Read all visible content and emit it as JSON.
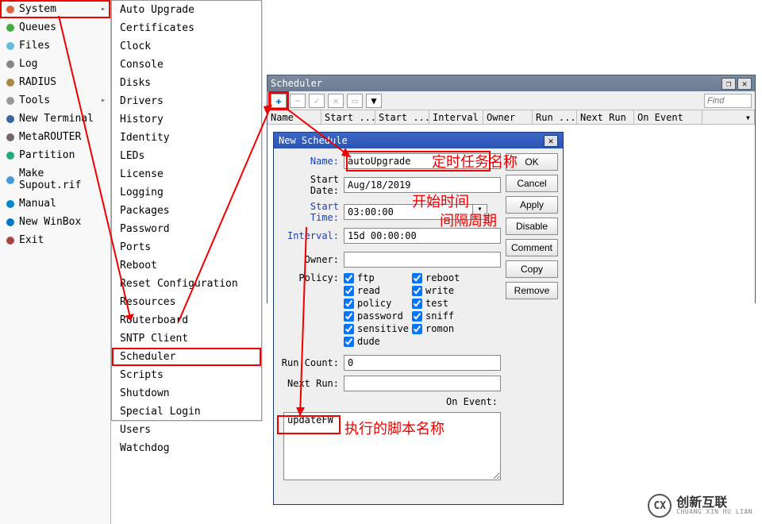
{
  "sidebar": {
    "items": [
      {
        "label": "System",
        "icon": "gear-icon",
        "highlight": true,
        "expandable": true
      },
      {
        "label": "Queues",
        "icon": "tree-icon"
      },
      {
        "label": "Files",
        "icon": "folder-icon"
      },
      {
        "label": "Log",
        "icon": "list-icon"
      },
      {
        "label": "RADIUS",
        "icon": "shield-icon"
      },
      {
        "label": "Tools",
        "icon": "wrench-icon",
        "expandable": true
      },
      {
        "label": "New Terminal",
        "icon": "terminal-icon"
      },
      {
        "label": "MetaROUTER",
        "icon": "router-icon"
      },
      {
        "label": "Partition",
        "icon": "pie-icon"
      },
      {
        "label": "Make Supout.rif",
        "icon": "doc-icon"
      },
      {
        "label": "Manual",
        "icon": "help-icon"
      },
      {
        "label": "New WinBox",
        "icon": "globe-icon"
      },
      {
        "label": "Exit",
        "icon": "exit-icon"
      }
    ]
  },
  "submenu": {
    "items": [
      "Auto Upgrade",
      "Certificates",
      "Clock",
      "Console",
      "Disks",
      "Drivers",
      "History",
      "Identity",
      "LEDs",
      "License",
      "Logging",
      "Packages",
      "Password",
      "Ports",
      "Reboot",
      "Reset Configuration",
      "Resources",
      "Routerboard",
      "SNTP Client",
      "Scheduler",
      "Scripts",
      "Shutdown",
      "Special Login",
      "Users",
      "Watchdog"
    ],
    "highlight_index": 19
  },
  "scheduler_window": {
    "title": "Scheduler",
    "find_placeholder": "Find",
    "columns": [
      "Name",
      "Start ...",
      "Start ...",
      "Interval",
      "Owner",
      "Run ...",
      "Next Run",
      "On Event"
    ]
  },
  "dialog": {
    "title": "New Schedule",
    "fields": {
      "name_label": "Name:",
      "name_value": "autoUpgrade",
      "start_date_label": "Start Date:",
      "start_date_value": "Aug/18/2019",
      "start_time_label": "Start Time:",
      "start_time_value": "03:00:00",
      "interval_label": "Interval:",
      "interval_value": "15d 00:00:00",
      "owner_label": "Owner:",
      "owner_value": "",
      "policy_label": "Policy:",
      "run_count_label": "Run Count:",
      "run_count_value": "0",
      "next_run_label": "Next Run:",
      "next_run_value": "",
      "on_event_label": "On Event:",
      "on_event_value": "updateFW"
    },
    "policies": [
      {
        "label": "ftp",
        "checked": true
      },
      {
        "label": "reboot",
        "checked": true
      },
      {
        "label": "read",
        "checked": true
      },
      {
        "label": "write",
        "checked": true
      },
      {
        "label": "policy",
        "checked": true
      },
      {
        "label": "test",
        "checked": true
      },
      {
        "label": "password",
        "checked": true
      },
      {
        "label": "sniff",
        "checked": true
      },
      {
        "label": "sensitive",
        "checked": true
      },
      {
        "label": "romon",
        "checked": true
      },
      {
        "label": "dude",
        "checked": true
      }
    ],
    "buttons": [
      "OK",
      "Cancel",
      "Apply",
      "Disable",
      "Comment",
      "Copy",
      "Remove"
    ]
  },
  "annotations": {
    "task_name": "定时任务名称",
    "start_time": "开始时间",
    "interval": "间隔周期",
    "script_name": "执行的脚本名称"
  },
  "watermark": {
    "brand_cn": "创新互联",
    "brand_en": "CHUANG XIN HU LIAN"
  }
}
